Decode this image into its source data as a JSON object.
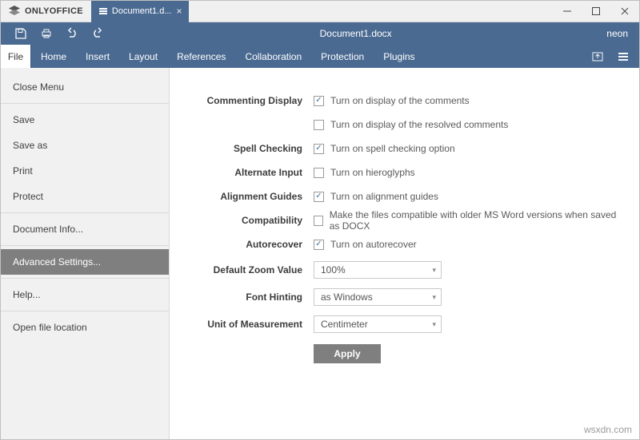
{
  "titlebar": {
    "brand": "ONLYOFFICE",
    "tab_label": "Document1.d..."
  },
  "qat": {
    "doc_title": "Document1.docx",
    "user": "neon"
  },
  "menubar": {
    "file_label": "File",
    "items": [
      "Home",
      "Insert",
      "Layout",
      "References",
      "Collaboration",
      "Protection",
      "Plugins"
    ]
  },
  "sidebar": {
    "close_menu": "Close Menu",
    "save": "Save",
    "save_as": "Save as",
    "print": "Print",
    "protect": "Protect",
    "doc_info": "Document Info...",
    "adv_settings": "Advanced Settings...",
    "help": "Help...",
    "open_loc": "Open file location"
  },
  "settings": {
    "commenting_label": "Commenting Display",
    "comments_on": "Turn on display of the comments",
    "comments_resolved": "Turn on display of the resolved comments",
    "spell_label": "Spell Checking",
    "spell_on": "Turn on spell checking option",
    "alt_label": "Alternate Input",
    "alt_on": "Turn on hieroglyphs",
    "align_label": "Alignment Guides",
    "align_on": "Turn on alignment guides",
    "compat_label": "Compatibility",
    "compat_on": "Make the files compatible with older MS Word versions when saved as DOCX",
    "autorec_label": "Autorecover",
    "autorec_on": "Turn on autorecover",
    "zoom_label": "Default Zoom Value",
    "zoom_value": "100%",
    "font_label": "Font Hinting",
    "font_value": "as Windows",
    "unit_label": "Unit of Measurement",
    "unit_value": "Centimeter",
    "apply": "Apply"
  },
  "watermark": "wsxdn.com"
}
